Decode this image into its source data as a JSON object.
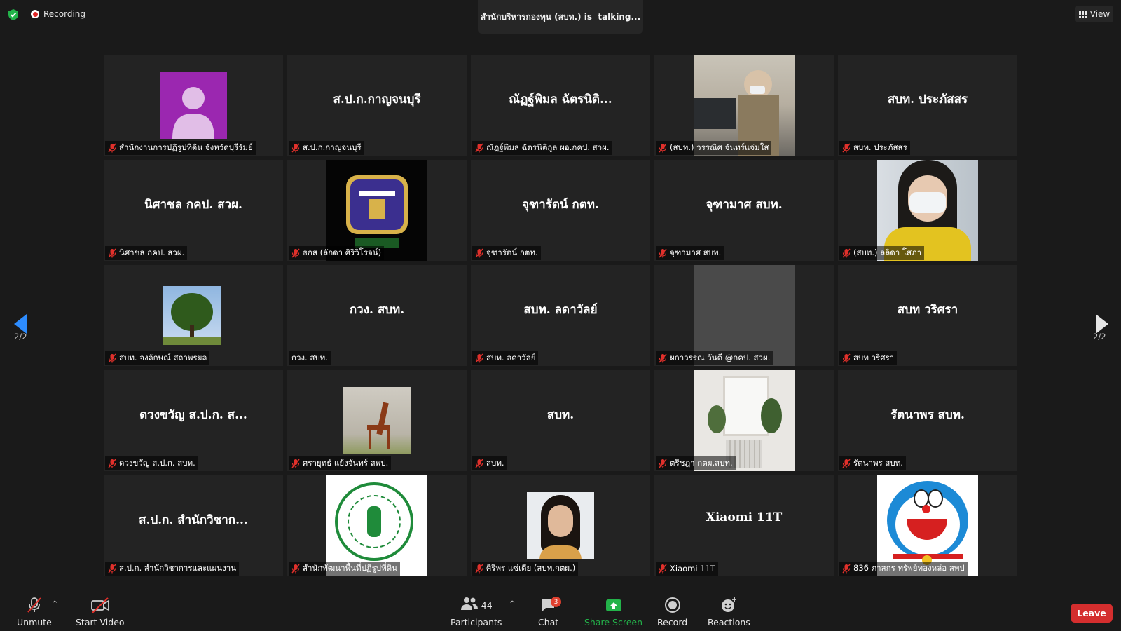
{
  "header": {
    "recording_label": "Recording",
    "talking_name": "สำนักบริหารกองทุน (สบท.)",
    "talking_suffix": " is  talking...",
    "view_label": "View"
  },
  "pagination": {
    "left": "2/2",
    "right": "2/2"
  },
  "participants": [
    {
      "label": "สำนักงานการปฏิรูปที่ดิน จังหวัดบุรีรัมย์",
      "display": "",
      "avatar": "default-avatar"
    },
    {
      "label": "ส.ป.ก.กาญจนบุรี",
      "display": "ส.ป.ก.กาญจนบุรี",
      "avatar": ""
    },
    {
      "label": "ณัฏฐ์พิมล ฉัตรนิติกูล ผอ.กคป. สวผ.",
      "display": "ณัฏฐ์พิมล ฉัตรนิติ...",
      "avatar": ""
    },
    {
      "label": "(สบท.) วรรณิศ จันทร์แจ่มใส",
      "display": "",
      "avatar": "office-photo"
    },
    {
      "label": "สบท. ประภัสสร",
      "display": "สบท. ประภัสสร",
      "avatar": ""
    },
    {
      "label": "นิศาชล กคป. สวผ.",
      "display": "นิศาชล กคป. สวผ.",
      "avatar": ""
    },
    {
      "label": "ธกส (ลักดา ศิริวิโรจน์)",
      "display": "",
      "avatar": "baac-logo"
    },
    {
      "label": "จุฑารัตน์ กตท.",
      "display": "จุฑารัตน์ กตท.",
      "avatar": ""
    },
    {
      "label": "จุฑามาศ สบท.",
      "display": "จุฑามาศ สบท.",
      "avatar": ""
    },
    {
      "label": "(สบท.) ลลิดา โสภา",
      "display": "",
      "avatar": "woman-mask-photo"
    },
    {
      "label": "สบท. จงลักษณ์ สถาพรผล",
      "display": "",
      "avatar": "tree-photo"
    },
    {
      "label": "กวง. สบท.",
      "display": "กวง. สบท.",
      "avatar": "",
      "muted": false
    },
    {
      "label": "สบท. ลดาวัลย์",
      "display": "สบท. ลดาวัลย์",
      "avatar": ""
    },
    {
      "label": "ผกาวรรณ วันดี @กคป. สวผ.",
      "display": "",
      "avatar": "grey-box"
    },
    {
      "label": "สบท วริศรา",
      "display": "สบท วริศรา",
      "avatar": ""
    },
    {
      "label": "ดวงขวัญ ส.ป.ก. สบท.",
      "display": "ดวงขวัญ ส.ป.ก. ส...",
      "avatar": ""
    },
    {
      "label": "ศรายุทธ์ แย้งจันทร์ สพป.",
      "display": "",
      "avatar": "chair-photo"
    },
    {
      "label": "สบท.",
      "display": "สบท.",
      "avatar": ""
    },
    {
      "label": "ตรีชฎา กตผ.สบท.",
      "display": "",
      "avatar": "window-plants-photo"
    },
    {
      "label": "รัตนาพร สบท.",
      "display": "รัตนาพร สบท.",
      "avatar": ""
    },
    {
      "label": "ส.ป.ก. สำนักวิชาการและแผนงาน",
      "display": "ส.ป.ก. สำนักวิชาก...",
      "avatar": ""
    },
    {
      "label": "สำนักพัฒนาพื้นที่ปฏิรูปที่ดิน",
      "display": "",
      "avatar": "alro-seal"
    },
    {
      "label": "ศิริพร แซ่เตีย (สบท.กตผ.)",
      "display": "",
      "avatar": "woman-portrait-photo"
    },
    {
      "label": "Xiaomi 11T",
      "display": "Xiaomi 11T",
      "avatar": ""
    },
    {
      "label": "836 ภาสกร ทรัพย์ทองหล่อ สพป",
      "display": "",
      "avatar": "doraemon-picture"
    }
  ],
  "toolbar": {
    "unmute": "Unmute",
    "start_video": "Start Video",
    "participants": "Participants",
    "participants_count": "44",
    "chat": "Chat",
    "chat_badge": "3",
    "share_screen": "Share Screen",
    "record": "Record",
    "reactions": "Reactions",
    "leave": "Leave"
  },
  "colors": {
    "background": "#1a1a1a",
    "tile": "#232323",
    "share_green": "#23b34a",
    "leave_red": "#d42e2e",
    "mute_red": "#e0302b",
    "arrow_blue": "#2d8cff"
  }
}
